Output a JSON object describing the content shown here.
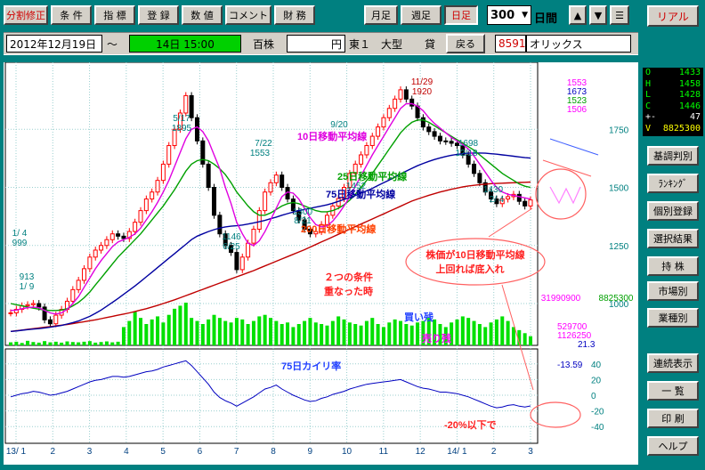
{
  "toolbar": {
    "split_fix": "分割修正",
    "conditions": "条 件",
    "indicators": "指 標",
    "register": "登 録",
    "values": "数 値",
    "comment": "コメント",
    "financial": "財 務",
    "monthly": "月足",
    "weekly": "週足",
    "daily": "日足",
    "period_value": "300",
    "period_unit": "日間",
    "up_arrow": "▲",
    "down_arrow": "▼",
    "menu": "☰",
    "real": "リアル"
  },
  "infobar": {
    "date": "2012年12月19日",
    "tilde": "～",
    "range": "14日 15:00",
    "shares": "百株",
    "currency": "円",
    "market": "東１",
    "size": "大型",
    "lend": "貸",
    "back": "戻る",
    "code": "8591",
    "name": "オリックス"
  },
  "ohlc": [
    {
      "k": "O",
      "v": "1433"
    },
    {
      "k": "H",
      "v": "1458"
    },
    {
      "k": "L",
      "v": "1428"
    },
    {
      "k": "C",
      "v": "1446"
    },
    {
      "k": "+-",
      "v": "47"
    },
    {
      "k": "V",
      "v": "8825300"
    }
  ],
  "sidebar": {
    "fundamentals": "基調判別",
    "ranking": "ﾗﾝｷﾝｸﾞ",
    "individual": "個別登録",
    "selection": "選択結果",
    "stocks": "持 株",
    "market": "市場別",
    "industry": "業種別",
    "continuous": "連続表示",
    "list": "一 覧",
    "print": "印 刷",
    "help": "ヘルプ"
  },
  "chart_data": {
    "type": "line",
    "price_axis": {
      "ticks": [
        1000,
        1250,
        1500,
        1750
      ],
      "ylim": [
        820,
        2000
      ]
    },
    "price_labels": {
      "top": [
        "1553",
        "1673",
        "1523",
        "1506"
      ],
      "vol_left": "31990900",
      "vol_right": "8825300"
    },
    "annotations": {
      "p1": "1/ 4",
      "p1v": "999",
      "p2": "5/17",
      "p2v": "1895",
      "p3": "7/22",
      "p3v": "1553",
      "p4": "9/20",
      "p4v": "1452",
      "p5": "11/29",
      "p5v": "1920",
      "p6": "1698",
      "p6d": "12/18",
      "p7": "1430",
      "p7d": "2/ 4",
      "p8": "1146",
      "p8d": "6/25",
      "p9": "1300",
      "p9d": "8/21",
      "p10": "913",
      "p10d": "1/ 9"
    },
    "ma_labels": {
      "ma10": "10日移動平均線",
      "ma25": "25日移動平均線",
      "ma75": "75日移動平均線",
      "ma200": "200日移動平均線"
    },
    "notes": {
      "cond_a": "株価が10日移動平均線",
      "cond_b": "上回れば底入れ",
      "two_a": "２つの条件",
      "two_b": "重なった時",
      "below": "-20%以下で"
    },
    "volume_labels": {
      "buy": "買い残",
      "sell": "売り残",
      "v1": "529700",
      "v2": "1126250",
      "v3": "21.3"
    },
    "deviation": {
      "label": "75日カイリ率",
      "current": "-13.59",
      "ticks": [
        40,
        20,
        0,
        -20,
        -40
      ],
      "ylim": [
        -50,
        50
      ]
    },
    "x_ticks": [
      "13/ 1",
      "2",
      "3",
      "4",
      "5",
      "6",
      "7",
      "8",
      "9",
      "10",
      "11",
      "12",
      "14/ 1",
      "2",
      "3"
    ],
    "close": [
      960,
      975,
      990,
      995,
      1000,
      985,
      930,
      913,
      950,
      975,
      1010,
      1060,
      1100,
      1150,
      1200,
      1230,
      1250,
      1275,
      1300,
      1290,
      1280,
      1310,
      1350,
      1400,
      1450,
      1480,
      1530,
      1600,
      1680,
      1750,
      1820,
      1895,
      1800,
      1700,
      1600,
      1500,
      1380,
      1300,
      1250,
      1220,
      1146,
      1200,
      1260,
      1320,
      1400,
      1480,
      1520,
      1553,
      1500,
      1450,
      1400,
      1360,
      1320,
      1300,
      1310,
      1340,
      1380,
      1420,
      1452,
      1500,
      1560,
      1600,
      1640,
      1680,
      1720,
      1760,
      1800,
      1840,
      1880,
      1920,
      1880,
      1850,
      1800,
      1760,
      1740,
      1720,
      1700,
      1698,
      1690,
      1680,
      1640,
      1600,
      1560,
      1520,
      1480,
      1450,
      1430,
      1450,
      1460,
      1470,
      1440,
      1420,
      1446
    ],
    "ma10": [
      970,
      972,
      978,
      982,
      985,
      982,
      970,
      960,
      955,
      960,
      975,
      1000,
      1030,
      1070,
      1110,
      1150,
      1185,
      1215,
      1245,
      1265,
      1275,
      1285,
      1300,
      1325,
      1360,
      1395,
      1435,
      1480,
      1530,
      1590,
      1650,
      1710,
      1750,
      1760,
      1740,
      1700,
      1640,
      1580,
      1500,
      1430,
      1350,
      1300,
      1260,
      1250,
      1270,
      1310,
      1360,
      1410,
      1460,
      1480,
      1475,
      1450,
      1410,
      1370,
      1340,
      1330,
      1335,
      1355,
      1385,
      1420,
      1460,
      1505,
      1550,
      1595,
      1640,
      1680,
      1720,
      1760,
      1800,
      1840,
      1860,
      1860,
      1850,
      1830,
      1800,
      1775,
      1755,
      1735,
      1715,
      1700,
      1685,
      1665,
      1635,
      1600,
      1565,
      1530,
      1500,
      1480,
      1470,
      1465,
      1460,
      1455,
      1450
    ],
    "ma25": [
      1000,
      995,
      990,
      985,
      980,
      976,
      972,
      970,
      970,
      972,
      978,
      990,
      1005,
      1025,
      1050,
      1080,
      1110,
      1140,
      1170,
      1200,
      1225,
      1250,
      1275,
      1300,
      1330,
      1360,
      1390,
      1420,
      1455,
      1490,
      1530,
      1570,
      1600,
      1615,
      1620,
      1615,
      1600,
      1580,
      1555,
      1520,
      1480,
      1450,
      1420,
      1395,
      1380,
      1380,
      1390,
      1405,
      1420,
      1430,
      1435,
      1430,
      1420,
      1410,
      1400,
      1395,
      1395,
      1400,
      1410,
      1425,
      1445,
      1470,
      1500,
      1530,
      1560,
      1595,
      1630,
      1665,
      1700,
      1735,
      1760,
      1780,
      1790,
      1790,
      1780,
      1765,
      1750,
      1735,
      1720,
      1705,
      1690,
      1675,
      1660,
      1640,
      1620,
      1600,
      1580,
      1560,
      1545,
      1530,
      1515,
      1505,
      1500
    ],
    "ma75": [
      880,
      882,
      885,
      888,
      890,
      892,
      895,
      898,
      902,
      906,
      912,
      918,
      925,
      935,
      945,
      958,
      972,
      988,
      1005,
      1022,
      1040,
      1058,
      1076,
      1095,
      1115,
      1135,
      1155,
      1175,
      1195,
      1215,
      1235,
      1255,
      1275,
      1290,
      1300,
      1310,
      1318,
      1325,
      1330,
      1333,
      1335,
      1338,
      1342,
      1347,
      1352,
      1358,
      1365,
      1372,
      1380,
      1387,
      1394,
      1400,
      1405,
      1410,
      1415,
      1420,
      1425,
      1432,
      1440,
      1448,
      1456,
      1465,
      1475,
      1485,
      1496,
      1508,
      1520,
      1532,
      1545,
      1558,
      1570,
      1582,
      1593,
      1603,
      1612,
      1620,
      1627,
      1633,
      1638,
      1642,
      1645,
      1647,
      1648,
      1648,
      1647,
      1645,
      1643,
      1640,
      1637,
      1634,
      1631,
      1628,
      1626
    ],
    "ma200": [
      880,
      883,
      886,
      889,
      892,
      895,
      898,
      901,
      904,
      907,
      910,
      914,
      918,
      922,
      926,
      930,
      935,
      940,
      945,
      950,
      955,
      960,
      966,
      972,
      978,
      985,
      992,
      1000,
      1008,
      1016,
      1025,
      1034,
      1043,
      1052,
      1061,
      1070,
      1079,
      1088,
      1097,
      1106,
      1115,
      1124,
      1133,
      1142,
      1152,
      1162,
      1172,
      1182,
      1192,
      1202,
      1212,
      1222,
      1232,
      1243,
      1254,
      1265,
      1276,
      1287,
      1298,
      1309,
      1320,
      1331,
      1342,
      1353,
      1364,
      1375,
      1386,
      1397,
      1408,
      1419,
      1430,
      1441,
      1450,
      1458,
      1466,
      1473,
      1480,
      1486,
      1492,
      1497,
      1502,
      1506,
      1509,
      1512,
      1514,
      1516,
      1517,
      1518,
      1519,
      1520,
      1521,
      1522,
      1523
    ],
    "volume": [
      10,
      12,
      8,
      15,
      11,
      9,
      14,
      10,
      12,
      9,
      13,
      11,
      10,
      12,
      14,
      9,
      11,
      13,
      10,
      12,
      60,
      80,
      110,
      90,
      70,
      85,
      95,
      75,
      100,
      120,
      130,
      140,
      90,
      80,
      70,
      85,
      100,
      90,
      80,
      75,
      90,
      85,
      70,
      80,
      95,
      100,
      90,
      80,
      70,
      75,
      60,
      70,
      80,
      90,
      75,
      70,
      65,
      80,
      95,
      85,
      75,
      70,
      65,
      80,
      90,
      70,
      60,
      75,
      85,
      80,
      70,
      65,
      75,
      80,
      90,
      85,
      70,
      60,
      75,
      85,
      95,
      90,
      80,
      70,
      60,
      75,
      85,
      95,
      80,
      60,
      50,
      40,
      30
    ],
    "deviation_values": [
      -2,
      0,
      2,
      3,
      5,
      4,
      2,
      0,
      1,
      3,
      5,
      8,
      11,
      14,
      17,
      19,
      20,
      22,
      24,
      24,
      23,
      24,
      26,
      28,
      30,
      31,
      33,
      36,
      38,
      40,
      42,
      44,
      38,
      30,
      22,
      14,
      4,
      -3,
      -7,
      -10,
      -14,
      -10,
      -6,
      -2,
      3,
      8,
      10,
      13,
      8,
      4,
      0,
      -3,
      -6,
      -8,
      -7,
      -4,
      -2,
      1,
      3,
      5,
      8,
      10,
      12,
      14,
      15,
      16,
      17,
      18,
      19,
      20,
      17,
      14,
      11,
      9,
      8,
      6,
      4,
      4,
      3,
      2,
      0,
      -2,
      -5,
      -8,
      -11,
      -14,
      -16,
      -15,
      -13,
      -12,
      -14,
      -15,
      -13.59
    ]
  }
}
